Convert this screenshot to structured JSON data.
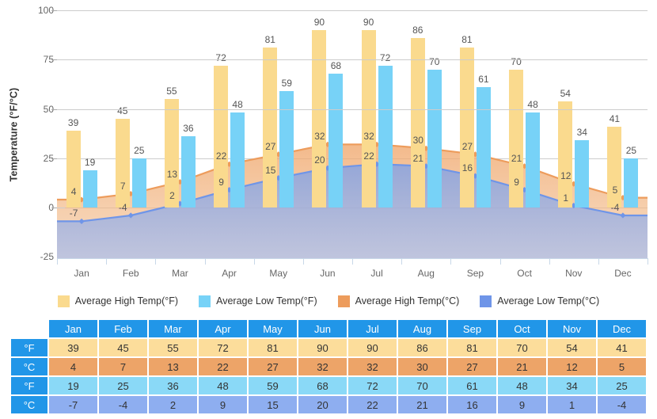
{
  "chart_data": {
    "type": "bar",
    "title": "",
    "subtitle": "",
    "xlabel": "",
    "ylabel": "Temperature (°F/°C)",
    "ylim": [
      -25,
      100
    ],
    "yticks": [
      100,
      75,
      50,
      25,
      0,
      -25
    ],
    "grid": true,
    "legend_position": "bottom",
    "categories": [
      "Jan",
      "Feb",
      "Mar",
      "Apr",
      "May",
      "Jun",
      "Jul",
      "Aug",
      "Sep",
      "Oct",
      "Nov",
      "Dec"
    ],
    "series": [
      {
        "name": "Average High Temp(°F)",
        "type": "bar",
        "color": "#fada8e",
        "values": [
          39,
          45,
          55,
          72,
          81,
          90,
          90,
          86,
          81,
          70,
          54,
          41
        ]
      },
      {
        "name": "Average Low Temp(°F)",
        "type": "bar",
        "color": "#77d2f7",
        "values": [
          19,
          25,
          36,
          48,
          59,
          68,
          72,
          70,
          61,
          48,
          34,
          25
        ]
      },
      {
        "name": "Average High Temp(°C)",
        "type": "area",
        "color": "#ed9c5c",
        "values": [
          4,
          7,
          13,
          22,
          27,
          32,
          32,
          30,
          27,
          21,
          12,
          5
        ]
      },
      {
        "name": "Average Low Temp(°C)",
        "type": "area",
        "color": "#6f95e8",
        "values": [
          -7,
          -4,
          2,
          9,
          15,
          20,
          22,
          21,
          16,
          9,
          1,
          -4
        ]
      }
    ]
  },
  "legend": {
    "items": [
      {
        "label": "Average High Temp(°F)",
        "color": "#fada8e"
      },
      {
        "label": "Average Low Temp(°F)",
        "color": "#77d2f7"
      },
      {
        "label": "Average High Temp(°C)",
        "color": "#ed9c5c"
      },
      {
        "label": "Average Low Temp(°C)",
        "color": "#6f95e8"
      }
    ]
  },
  "table": {
    "corner": "",
    "month_headers": [
      "Jan",
      "Feb",
      "Mar",
      "Apr",
      "May",
      "Jun",
      "Jul",
      "Aug",
      "Sep",
      "Oct",
      "Nov",
      "Dec"
    ],
    "rows": [
      {
        "unit": "°F",
        "style": "c-high-f",
        "values": [
          "39",
          "45",
          "55",
          "72",
          "81",
          "90",
          "90",
          "86",
          "81",
          "70",
          "54",
          "41"
        ]
      },
      {
        "unit": "°C",
        "style": "c-high-c",
        "values": [
          "4",
          "7",
          "13",
          "22",
          "27",
          "32",
          "32",
          "30",
          "27",
          "21",
          "12",
          "5"
        ]
      },
      {
        "unit": "°F",
        "style": "c-low-f",
        "values": [
          "19",
          "25",
          "36",
          "48",
          "59",
          "68",
          "72",
          "70",
          "61",
          "48",
          "34",
          "25"
        ]
      },
      {
        "unit": "°C",
        "style": "c-low-c",
        "values": [
          "-7",
          "-4",
          "2",
          "9",
          "15",
          "20",
          "22",
          "21",
          "16",
          "9",
          "1",
          "-4"
        ]
      }
    ]
  },
  "colors": {
    "high_f_bar": "#fada8e",
    "low_f_bar": "#77d2f7",
    "high_c_area": "#ed9c5c",
    "low_c_area": "#6f95e8",
    "table_header": "#2196e8",
    "gridline": "#cccccc",
    "axis_text": "#666666"
  }
}
